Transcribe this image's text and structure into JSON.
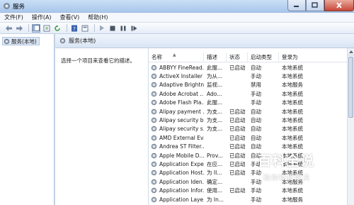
{
  "window": {
    "title": "服务"
  },
  "menu": [
    "文件(F)",
    "操作(A)",
    "查看(V)",
    "帮助(H)"
  ],
  "toolbar": [
    "back-arrow-icon",
    "forward-arrow-icon",
    "console-tree-icon",
    "export-list-icon",
    "refresh-icon",
    "help-icon",
    "properties-icon",
    "play-icon",
    "stop-icon",
    "pause-icon",
    "restart-icon"
  ],
  "tree": {
    "item": "服务(本地)"
  },
  "header": {
    "title": "服务(本地)"
  },
  "description": {
    "text": "选择一个项目来查看它的描述。"
  },
  "columns": {
    "name": "名称",
    "desc": "描述",
    "status": "状态",
    "startup": "启动类型",
    "logon": "登录为"
  },
  "services": [
    {
      "name": "ABBYY FineRead...",
      "desc": "此服...",
      "status": "已启动",
      "startup": "自动",
      "logon": "本地系统"
    },
    {
      "name": "ActiveX Installer ...",
      "desc": "为从...",
      "status": "",
      "startup": "手动",
      "logon": "本地系统"
    },
    {
      "name": "Adaptive Brightn...",
      "desc": "监视...",
      "status": "",
      "startup": "禁用",
      "logon": "本地服务"
    },
    {
      "name": "Adobe Acrobat ...",
      "desc": "Ado...",
      "status": "",
      "startup": "手动",
      "logon": "本地系统"
    },
    {
      "name": "Adobe Flash Pla...",
      "desc": "此服...",
      "status": "",
      "startup": "手动",
      "logon": "本地系统"
    },
    {
      "name": "Alipay payment ...",
      "desc": "为支...",
      "status": "已启动",
      "startup": "自动",
      "logon": "本地系统"
    },
    {
      "name": "Alipay security b...",
      "desc": "为支...",
      "status": "已启动",
      "startup": "自动",
      "logon": "本地系统"
    },
    {
      "name": "Alipay security s...",
      "desc": "为支...",
      "status": "已启动",
      "startup": "自动",
      "logon": "本地系统"
    },
    {
      "name": "AMD External Ev...",
      "desc": "",
      "status": "已启动",
      "startup": "自动",
      "logon": "本地系统"
    },
    {
      "name": "Andrea ST Filter...",
      "desc": "",
      "status": "已启动",
      "startup": "自动",
      "logon": "本地系统"
    },
    {
      "name": "Apple Mobile D...",
      "desc": "Prov...",
      "status": "已启动",
      "startup": "自动",
      "logon": "本地系统"
    },
    {
      "name": "Application Expe...",
      "desc": "在应...",
      "status": "已启动",
      "startup": "手动",
      "logon": "本地系统"
    },
    {
      "name": "Application Host...",
      "desc": "为 II...",
      "status": "已启动",
      "startup": "手动",
      "logon": "本地系统"
    },
    {
      "name": "Application Iden...",
      "desc": "确定...",
      "status": "",
      "startup": "手动",
      "logon": "本地服务"
    },
    {
      "name": "Application Infor...",
      "desc": "使用...",
      "status": "已启动",
      "startup": "手动",
      "logon": "本地系统"
    },
    {
      "name": "Application Laye...",
      "desc": "为 In...",
      "status": "",
      "startup": "手动",
      "logon": "本地服务"
    }
  ],
  "watermark": {
    "title": "百科全说",
    "subtitle": "助你轻松解决"
  }
}
